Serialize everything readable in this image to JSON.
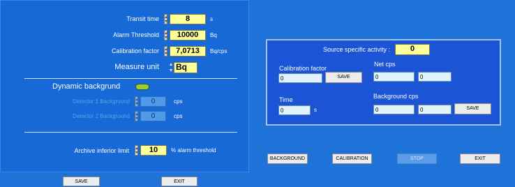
{
  "left": {
    "transit": {
      "label": "Transit time",
      "value": "8",
      "unit": "s"
    },
    "alarm": {
      "label": "Alarm Threshold",
      "value": "10000",
      "unit": "Bq"
    },
    "calib": {
      "label": "Calibration factor",
      "value": "7,0713",
      "unit": "Bq/cps"
    },
    "measure": {
      "label": "Measure unit",
      "value": "Bq"
    },
    "dynamic": {
      "label": "Dynamic backgrund"
    },
    "det1": {
      "label": "Detector 1 Background",
      "value": "0",
      "unit": "cps"
    },
    "det2": {
      "label": "Detector 2 Background",
      "value": "0",
      "unit": "cps"
    },
    "archive": {
      "label": "Archive inferior limit",
      "value": "10",
      "unit": "% alarm threshold"
    }
  },
  "right": {
    "source": {
      "label": "Source specific activity :",
      "value": "0"
    },
    "calib": {
      "label": "Calibration factor",
      "value": "0",
      "save": "SAVE"
    },
    "netcps": {
      "label": "Net cps",
      "value1": "0",
      "value2": "0"
    },
    "time": {
      "label": "Time",
      "value": "0",
      "unit": "s"
    },
    "bgcps": {
      "label": "Background cps",
      "value1": "0",
      "value2": "0",
      "save": "SAVE"
    }
  },
  "buttons": {
    "background": "BACKGROUND",
    "calibration": "CALIBRATION",
    "stop": "STOP",
    "exit_right": "EXIT",
    "save_bottom": "SAVE",
    "exit_bottom": "EXIT"
  },
  "colors": {
    "background": "#1f73d8",
    "panel": "#1669d6",
    "inner_panel": "#1b55d6",
    "input_yellow": "#ffff99",
    "toggle": "#9acd32"
  }
}
